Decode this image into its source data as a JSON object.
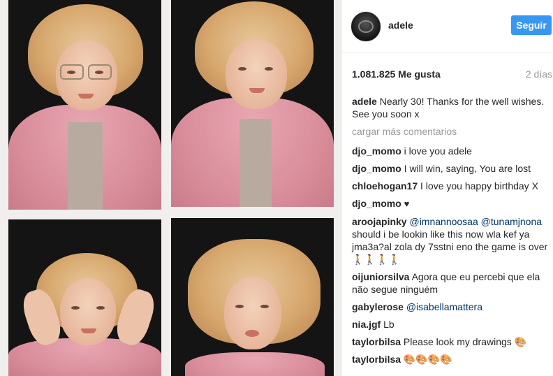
{
  "post": {
    "username": "adele",
    "follow_label": "Seguir",
    "likes": "1.081.825 Me gusta",
    "time_ago": "2 días",
    "caption_user": "adele",
    "caption_text": "Nearly 30! Thanks for the well wishes. See you soon x",
    "load_more": "cargar más comentarios"
  },
  "comments": [
    {
      "user": "djo_momo",
      "text": "i love you adele"
    },
    {
      "user": "djo_momo",
      "text": "I will win, saying, You are lost"
    },
    {
      "user": "chloehogan17",
      "text": "I love you happy birthday X"
    },
    {
      "user": "djo_momo",
      "text": "♥"
    },
    {
      "user": "aroojapinky",
      "mention1": "@imnannoosaa",
      "mention2": "@tunamjnona",
      "text": " should i be lookin like this now wla kef ya jma3a?al zola dy 7sstni eno the game is over🚶🚶🚶🚶"
    },
    {
      "user": "oijuniorsilva",
      "text": "Agora que eu percebi que ela não segue ninguém"
    },
    {
      "user": "gabylerose",
      "mention1": "@isabellamattera"
    },
    {
      "user": "nia.jgf",
      "text": "Lb"
    },
    {
      "user": "taylorbilsa",
      "text": "Please look my drawings 🎨"
    },
    {
      "user": "taylorbilsa",
      "text": "🎨🎨🎨🎨"
    }
  ],
  "colors": {
    "follow_button": "#3897f0",
    "mention": "#003569",
    "muted": "#999999"
  }
}
